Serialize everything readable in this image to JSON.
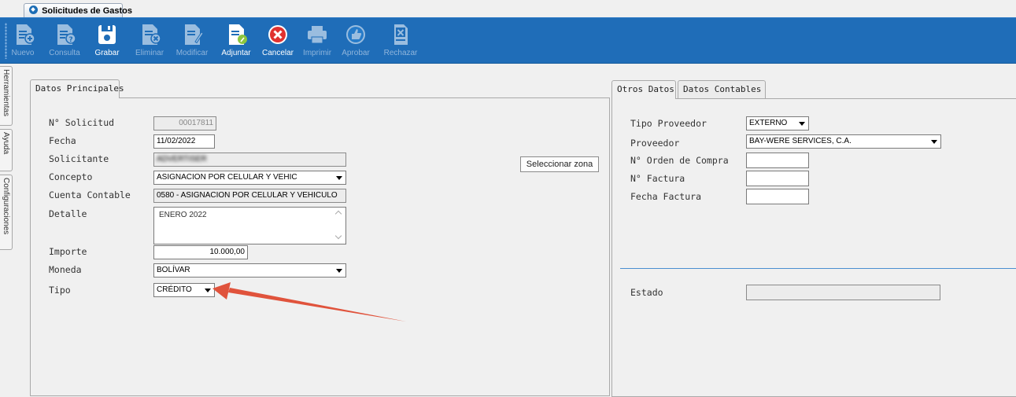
{
  "window": {
    "tab_title": "Solicitudes de Gastos"
  },
  "toolbar": {
    "buttons": [
      {
        "label": "Nuevo",
        "icon": "new-document-icon",
        "enabled": false
      },
      {
        "label": "Consulta",
        "icon": "query-document-icon",
        "enabled": false
      },
      {
        "label": "Grabar",
        "icon": "save-disk-icon",
        "enabled": true
      },
      {
        "label": "Eliminar",
        "icon": "delete-document-icon",
        "enabled": false
      },
      {
        "label": "Modificar",
        "icon": "edit-document-icon",
        "enabled": false
      },
      {
        "label": "Adjuntar",
        "icon": "attach-document-icon",
        "enabled": true
      },
      {
        "label": "Cancelar",
        "icon": "cancel-icon",
        "enabled": true
      },
      {
        "label": "Imprimir",
        "icon": "printer-icon",
        "enabled": false
      },
      {
        "label": "Aprobar",
        "icon": "thumbs-up-icon",
        "enabled": false
      },
      {
        "label": "Rechazar",
        "icon": "reject-icon",
        "enabled": false
      }
    ]
  },
  "side_tabs": [
    "Herramientas",
    "Ayuda",
    "Configuraciones"
  ],
  "left_panel": {
    "tab": "Datos Principales",
    "fields": {
      "solicitud": {
        "label": "N° Solicitud",
        "value": "00017811"
      },
      "fecha": {
        "label": "Fecha",
        "value": "11/02/2022"
      },
      "solicitante": {
        "label": "Solicitante",
        "value": "ADVERTISER"
      },
      "concepto": {
        "label": "Concepto",
        "value": "ASIGNACION POR CELULAR Y VEHIC"
      },
      "cuenta": {
        "label": "Cuenta Contable",
        "value": "0580 - ASIGNACION POR CELULAR Y VEHICULO"
      },
      "detalle": {
        "label": "Detalle",
        "value": "ENERO 2022"
      },
      "importe": {
        "label": "Importe",
        "value": "10.000,00"
      },
      "moneda": {
        "label": "Moneda",
        "value": "BOLÍVAR"
      },
      "tipo": {
        "label": "Tipo",
        "value": "CRÉDITO"
      }
    }
  },
  "zona_button": "Seleccionar zona",
  "right_panel": {
    "tabs": [
      "Otros Datos",
      "Datos Contables"
    ],
    "fields": {
      "tipo_proveedor": {
        "label": "Tipo Proveedor",
        "value": "EXTERNO"
      },
      "proveedor": {
        "label": "Proveedor",
        "value": "BAY-WERE SERVICES, C.A."
      },
      "orden_compra": {
        "label": "N° Orden de Compra",
        "value": ""
      },
      "factura": {
        "label": "N° Factura",
        "value": ""
      },
      "fecha_factura": {
        "label": "Fecha Factura",
        "value": ""
      },
      "estado": {
        "label": "Estado",
        "value": ""
      }
    }
  },
  "colors": {
    "toolbar_bg": "#1f6db8",
    "annotation_arrow": "#e0533c",
    "divider": "#4a8fd0"
  }
}
